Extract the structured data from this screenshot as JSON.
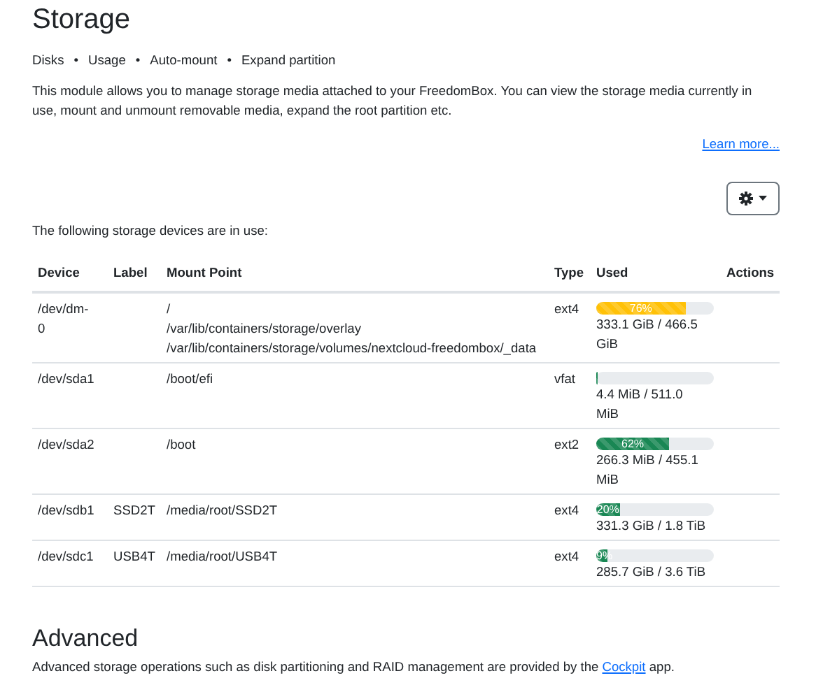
{
  "title": "Storage",
  "topics": [
    "Disks",
    "•",
    "Usage",
    "•",
    "Auto-mount",
    "•",
    "Expand partition"
  ],
  "description": "This module allows you to manage storage media attached to your FreedomBox. You can view the storage media currently in use, mount and unmount removable media, expand the root partition etc.",
  "learn_more": "Learn more...",
  "intro": "The following storage devices are in use:",
  "table": {
    "columns": [
      "Device",
      "Label",
      "Mount Point",
      "Type",
      "Used",
      "Actions"
    ],
    "rows": [
      {
        "device": "/dev/dm-0",
        "mount_points": [
          "/",
          "/var/lib/containers/storage/overlay",
          "/var/lib/containers/storage/volumes/nextcloud-freedombox/_data"
        ],
        "type": "ext4",
        "level": 0.76,
        "bar_label": "76%",
        "usage": "333.1 GiB / 466.5 GiB"
      },
      {
        "device": "/dev/sda1",
        "mount_points": [
          "/boot/efi"
        ],
        "type": "vfat",
        "level": 0.01,
        "usage": "4.4 MiB / 511.0 MiB"
      },
      {
        "device": "/dev/sda2",
        "mount_points": [
          "/boot"
        ],
        "type": "ext2",
        "level": 0.62,
        "bar_label": "62%",
        "usage": "266.3 MiB / 455.1 MiB"
      },
      {
        "device": "/dev/sdb1",
        "label": "SSD2T",
        "mount_points": [
          "/media/root/SSD2T"
        ],
        "type": "ext4",
        "level": 0.2,
        "bar_label": "20%",
        "usage": "331.3 GiB / 1.8 TiB"
      },
      {
        "device": "/dev/sdc1",
        "label": "USB4T",
        "mount_points": [
          "/media/root/USB4T"
        ],
        "type": "ext4",
        "level": 0.09,
        "bar_label": "9%",
        "usage": "285.7 GiB / 3.6 TiB"
      }
    ]
  },
  "advanced": {
    "heading": "Advanced",
    "text_before": "Advanced storage operations such as disk partitioning and RAID management are provided by the ",
    "link": "Cockpit",
    "text_after": " app."
  }
}
